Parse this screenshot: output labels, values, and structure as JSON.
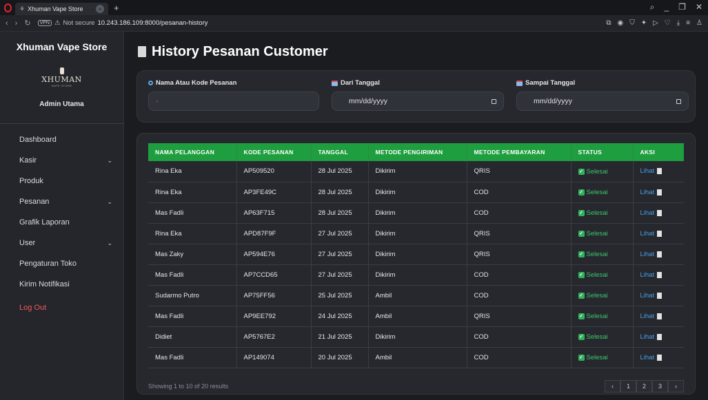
{
  "browser": {
    "tab_title": "Xhuman Vape Store",
    "security": "Not secure",
    "url": "10.243.186.109:8000/pesanan-history",
    "vpn": "VPN"
  },
  "sidebar": {
    "brand": "Xhuman Vape Store",
    "logo_text": "XHUMAN",
    "logo_sub": "VAPE STORE",
    "admin": "Admin Utama",
    "items": [
      {
        "label": "Dashboard",
        "has_children": false
      },
      {
        "label": "Kasir",
        "has_children": true
      },
      {
        "label": "Produk",
        "has_children": false
      },
      {
        "label": "Pesanan",
        "has_children": true
      },
      {
        "label": "Grafik Laporan",
        "has_children": false
      },
      {
        "label": "User",
        "has_children": true
      },
      {
        "label": "Pengaturan Toko",
        "has_children": false
      },
      {
        "label": "Kirim Notifikasi",
        "has_children": false
      }
    ],
    "logout": "Log Out"
  },
  "page": {
    "title": "History Pesanan Customer"
  },
  "filters": {
    "name_label": "Nama Atau Kode Pesanan",
    "name_placeholder": "-",
    "from_label": "Dari Tanggal",
    "from_value": "mm/dd/yyyy",
    "to_label": "Sampai Tanggal",
    "to_value": "mm/dd/yyyy"
  },
  "table": {
    "headers": [
      "NAMA PELANGGAN",
      "KODE PESANAN",
      "TANGGAL",
      "METODE PENGIRIMAN",
      "METODE PEMBAYARAN",
      "STATUS",
      "AKSI"
    ],
    "rows": [
      {
        "name": "Rina Eka",
        "code": "AP509520",
        "date": "28 Jul 2025",
        "shipping": "Dikirim",
        "payment": "QRIS",
        "status": "Selesai",
        "action": "Lihat"
      },
      {
        "name": "Rina Eka",
        "code": "AP3FE49C",
        "date": "28 Jul 2025",
        "shipping": "Dikirim",
        "payment": "COD",
        "status": "Selesai",
        "action": "Lihat"
      },
      {
        "name": "Mas Fadli",
        "code": "AP63F715",
        "date": "28 Jul 2025",
        "shipping": "Dikirim",
        "payment": "COD",
        "status": "Selesai",
        "action": "Lihat"
      },
      {
        "name": "Rina Eka",
        "code": "APD87F9F",
        "date": "27 Jul 2025",
        "shipping": "Dikirim",
        "payment": "QRIS",
        "status": "Selesai",
        "action": "Lihat"
      },
      {
        "name": "Mas Zaky",
        "code": "AP594E76",
        "date": "27 Jul 2025",
        "shipping": "Dikirim",
        "payment": "QRIS",
        "status": "Selesai",
        "action": "Lihat"
      },
      {
        "name": "Mas Fadli",
        "code": "AP7CCD65",
        "date": "27 Jul 2025",
        "shipping": "Dikirim",
        "payment": "COD",
        "status": "Selesai",
        "action": "Lihat"
      },
      {
        "name": "Sudarmo Putro",
        "code": "AP75FF56",
        "date": "25 Jul 2025",
        "shipping": "Ambil",
        "payment": "COD",
        "status": "Selesai",
        "action": "Lihat"
      },
      {
        "name": "Mas Fadli",
        "code": "AP9EE792",
        "date": "24 Jul 2025",
        "shipping": "Ambil",
        "payment": "QRIS",
        "status": "Selesai",
        "action": "Lihat"
      },
      {
        "name": "Didiet",
        "code": "AP5767E2",
        "date": "21 Jul 2025",
        "shipping": "Dikirim",
        "payment": "COD",
        "status": "Selesai",
        "action": "Lihat"
      },
      {
        "name": "Mas Fadli",
        "code": "AP149074",
        "date": "20 Jul 2025",
        "shipping": "Ambil",
        "payment": "COD",
        "status": "Selesai",
        "action": "Lihat"
      }
    ],
    "footer": "Showing 1 to 10 of 20 results",
    "pages": [
      "‹",
      "1",
      "2",
      "3",
      "›"
    ]
  },
  "colors": {
    "header_green": "#1f9e3f",
    "status_green": "#3ec46d",
    "link_blue": "#4a9fea",
    "logout_red": "#f05a5a"
  }
}
